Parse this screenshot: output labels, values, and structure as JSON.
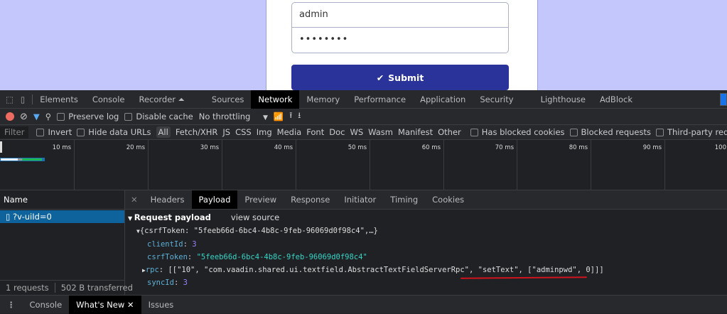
{
  "login": {
    "username": "admin",
    "password": "••••••••",
    "submit_label": "Submit"
  },
  "devtools": {
    "tabs": [
      "Elements",
      "Console",
      "Recorder ⏶",
      "Sources",
      "Network",
      "Memory",
      "Performance",
      "Application",
      "Security",
      "Lighthouse",
      "AdBlock"
    ],
    "active_tab": "Network",
    "toolbar": {
      "preserve_log": "Preserve log",
      "disable_cache": "Disable cache",
      "throttling": "No throttling"
    },
    "filter": {
      "placeholder": "Filter",
      "invert": "Invert",
      "hide_data_urls": "Hide data URLs",
      "types": [
        "All",
        "Fetch/XHR",
        "JS",
        "CSS",
        "Img",
        "Media",
        "Font",
        "Doc",
        "WS",
        "Wasm",
        "Manifest",
        "Other"
      ],
      "has_blocked_cookies": "Has blocked cookies",
      "blocked_requests": "Blocked requests",
      "third_party": "Third-party reque"
    },
    "timeline_ticks": [
      "10 ms",
      "20 ms",
      "30 ms",
      "40 ms",
      "50 ms",
      "60 ms",
      "70 ms",
      "80 ms",
      "90 ms",
      "100"
    ],
    "name_header": "Name",
    "requests": [
      {
        "name": "?v-uiId=0"
      }
    ],
    "status": {
      "requests": "1 requests",
      "transferred": "502 B transferred"
    },
    "detail_tabs": [
      "Headers",
      "Payload",
      "Preview",
      "Response",
      "Initiator",
      "Timing",
      "Cookies"
    ],
    "active_detail_tab": "Payload",
    "payload": {
      "title": "Request payload",
      "view_source": "view source",
      "summary": "{csrfToken: \"5feeb66d-6bc4-4b8c-9feb-96069d0f98c4\",…}",
      "clientId_key": "clientId",
      "clientId": "3",
      "csrfToken_key": "csrfToken",
      "csrfToken": "\"5feeb66d-6bc4-4b8c-9feb-96069d0f98c4\"",
      "rpc_key": "rpc",
      "rpc": "[[\"10\", \"com.vaadin.shared.ui.textfield.AbstractTextFieldServerRpc\", \"setText\", [\"adminpwd\", 0]]]",
      "syncId_key": "syncId",
      "syncId": "3"
    },
    "drawer_tabs": [
      "Console",
      "What's New",
      "Issues"
    ]
  }
}
